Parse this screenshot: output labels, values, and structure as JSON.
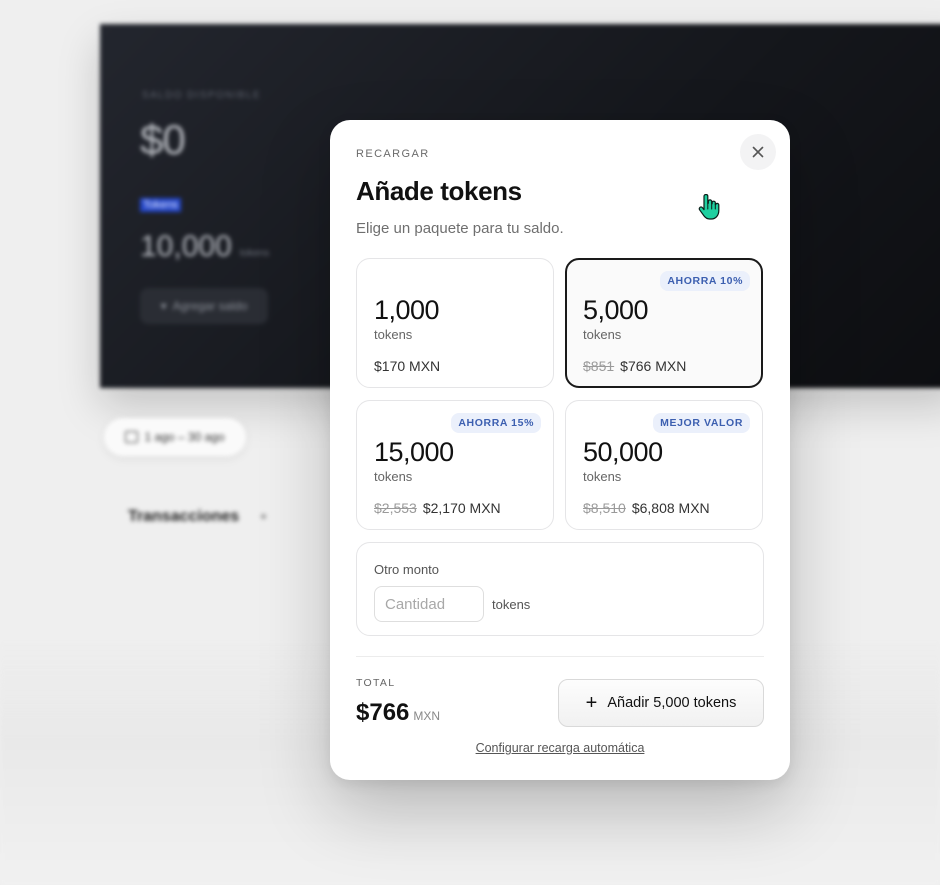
{
  "background": {
    "balance_label": "Saldo disponible",
    "balance": "$0",
    "tokens_chip": "Tokens",
    "tokens_value": "10,000",
    "tokens_unit": "tokens",
    "add_balance_button": "Agregar saldo",
    "date_range": "1 ago – 30 ago",
    "transactions_heading": "Transacciones"
  },
  "modal": {
    "eyebrow": "RECARGAR",
    "title": "Añade tokens",
    "subtitle": "Elige un paquete para tu saldo.",
    "close_icon": "close-icon",
    "packages": [
      {
        "amount": "1,000",
        "unit": "tokens",
        "old_price": "",
        "price": "$170 MXN",
        "badge": ""
      },
      {
        "amount": "5,000",
        "unit": "tokens",
        "old_price": "$851",
        "price": "$766 MXN",
        "badge": "AHORRA 10%"
      },
      {
        "amount": "15,000",
        "unit": "tokens",
        "old_price": "$2,553",
        "price": "$2,170 MXN",
        "badge": "AHORRA 15%"
      },
      {
        "amount": "50,000",
        "unit": "tokens",
        "old_price": "$8,510",
        "price": "$6,808 MXN",
        "badge": "MEJOR VALOR"
      }
    ],
    "selected_package_index": 1,
    "custom": {
      "label": "Otro monto",
      "placeholder": "Cantidad",
      "value": "",
      "unit": "tokens"
    },
    "total": {
      "label": "TOTAL",
      "amount": "$766",
      "currency": "MXN"
    },
    "cta_label": "Añadir 5,000 tokens",
    "auto_recharge_link": "Configurar recarga automática"
  },
  "colors": {
    "accent_badge_text": "#3c5fb0",
    "accent_badge_bg": "#ebf0fb",
    "selected_border": "#1a1a1a",
    "cursor": "#19c99a"
  }
}
